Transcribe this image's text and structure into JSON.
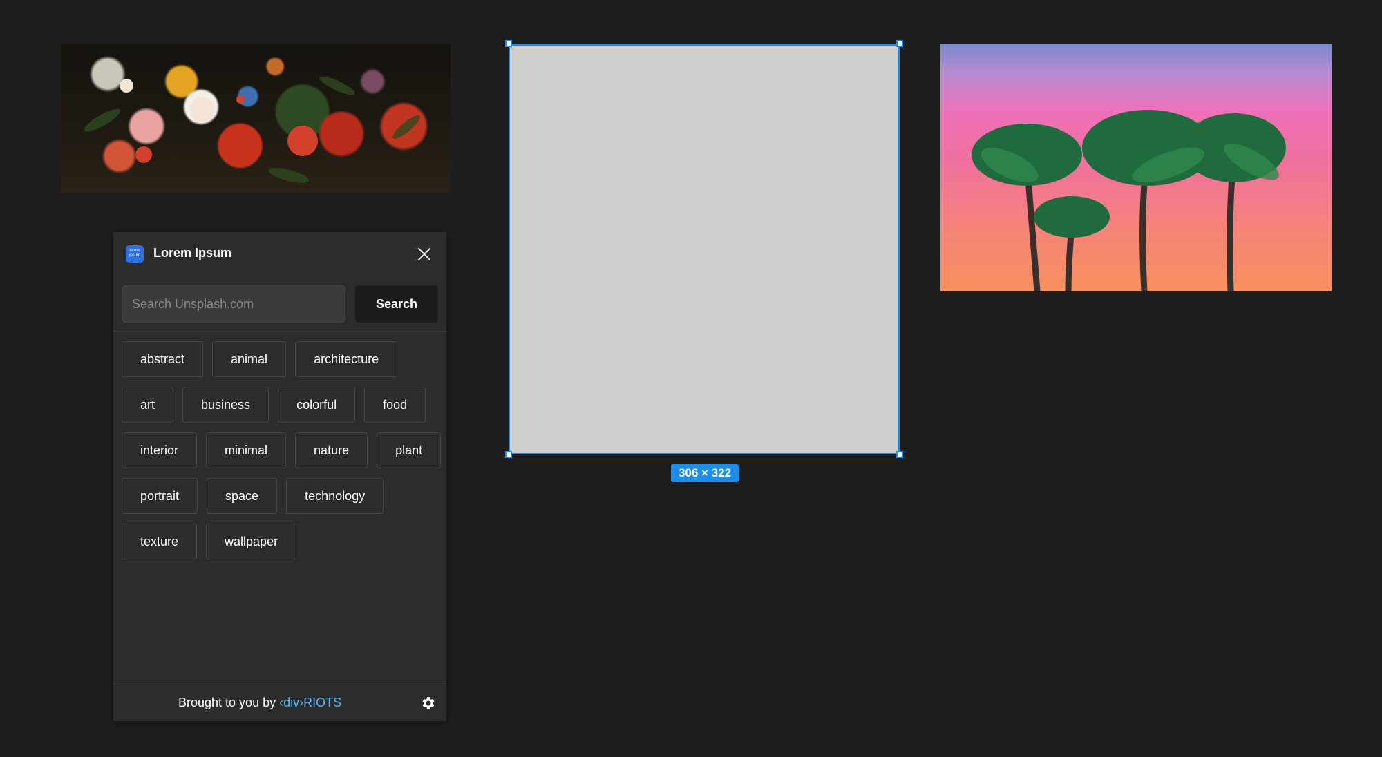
{
  "canvas": {
    "images": [
      {
        "name": "flowers-still-life"
      },
      {
        "name": "selected-placeholder-frame"
      },
      {
        "name": "palm-trees-sunset"
      }
    ],
    "selection": {
      "size_label": "306 × 322",
      "accent_color": "#1c8eea"
    }
  },
  "plugin": {
    "logo_text": "lorem ipsum",
    "title": "Lorem Ipsum",
    "close_icon": "close-icon",
    "search": {
      "placeholder": "Search Unsplash.com",
      "value": "",
      "button_label": "Search"
    },
    "tags": [
      "abstract",
      "animal",
      "architecture",
      "art",
      "business",
      "colorful",
      "food",
      "interior",
      "minimal",
      "nature",
      "plant",
      "portrait",
      "space",
      "technology",
      "texture",
      "wallpaper"
    ],
    "footer": {
      "prefix": "Brought to you by ",
      "link_text": "‹div›RIOTS",
      "link_color": "#5ab4f0",
      "settings_icon": "gear-icon"
    }
  }
}
